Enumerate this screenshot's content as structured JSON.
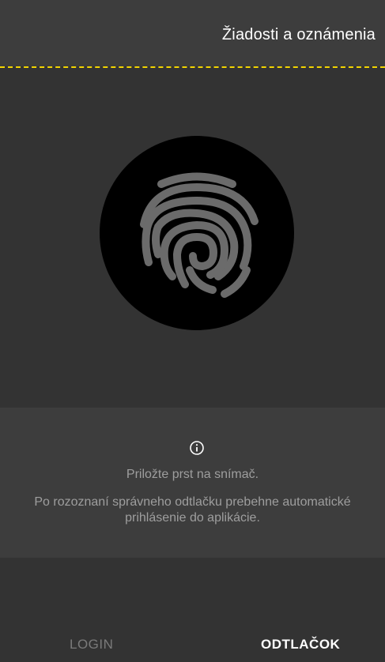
{
  "header": {
    "title": "Žiadosti a oznámenia"
  },
  "fingerprint": {
    "icon": "fingerprint-icon"
  },
  "info": {
    "icon": "info-icon",
    "instruction": "Priložte prst na snímač.",
    "description": "Po rozoznaní správneho odtlačku prebehne automatické prihlásenie do aplikácie."
  },
  "tabs": [
    {
      "label": "LOGIN",
      "active": false
    },
    {
      "label": "ODTLAČOK",
      "active": true
    }
  ],
  "colors": {
    "accent": "#f2d400",
    "background": "#333333",
    "panel": "#3d3d3d",
    "fingerprint": "#6b6b6b"
  }
}
